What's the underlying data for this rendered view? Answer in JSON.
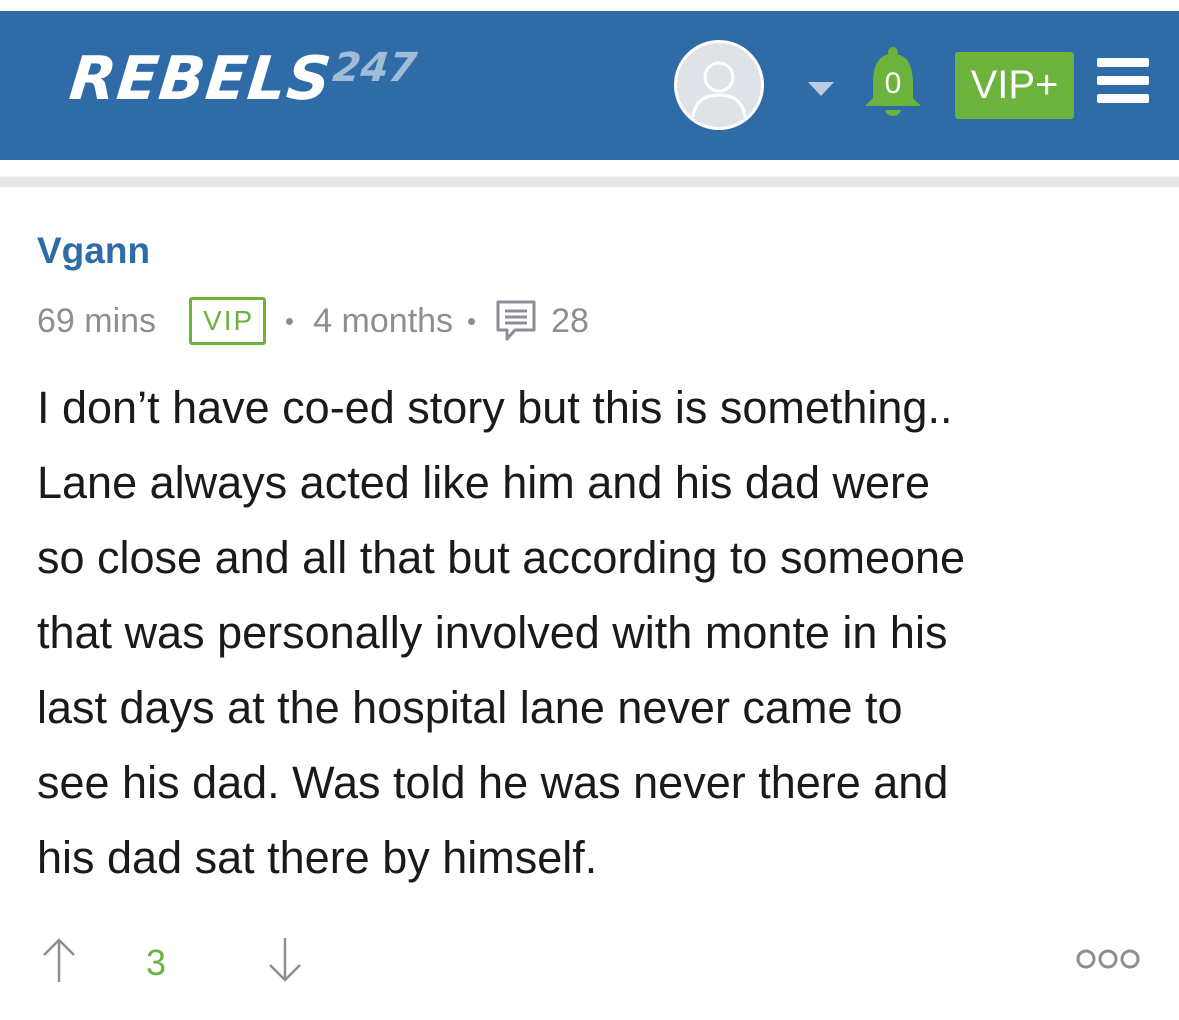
{
  "header": {
    "logo_main": "REBELS",
    "logo_number": "247",
    "notification_count": "0",
    "vip_plus_label": "VIP+",
    "brand_color": "#2f6ba6",
    "accent_color": "#6cb33e"
  },
  "post": {
    "username": "Vgann",
    "time_ago": "69 mins",
    "badge": "VIP",
    "member_since": "4 months",
    "comment_count": "28",
    "body_lines": [
      "I don’t have co-ed story but this is something..",
      "Lane always acted like him and his dad were",
      "so close and all that but according to someone",
      "that was personally involved with monte in his",
      "last days at the hospital lane never came to",
      "see his dad. Was told he was never there and",
      "his dad sat there by himself."
    ],
    "vote_score": "3"
  },
  "icons": {
    "avatar": "user-avatar-icon",
    "caret": "chevron-down-icon",
    "bell": "bell-icon",
    "menu": "hamburger-menu-icon",
    "comment": "comment-icon",
    "upvote": "arrow-up-icon",
    "downvote": "arrow-down-icon",
    "more": "more-options-icon"
  }
}
